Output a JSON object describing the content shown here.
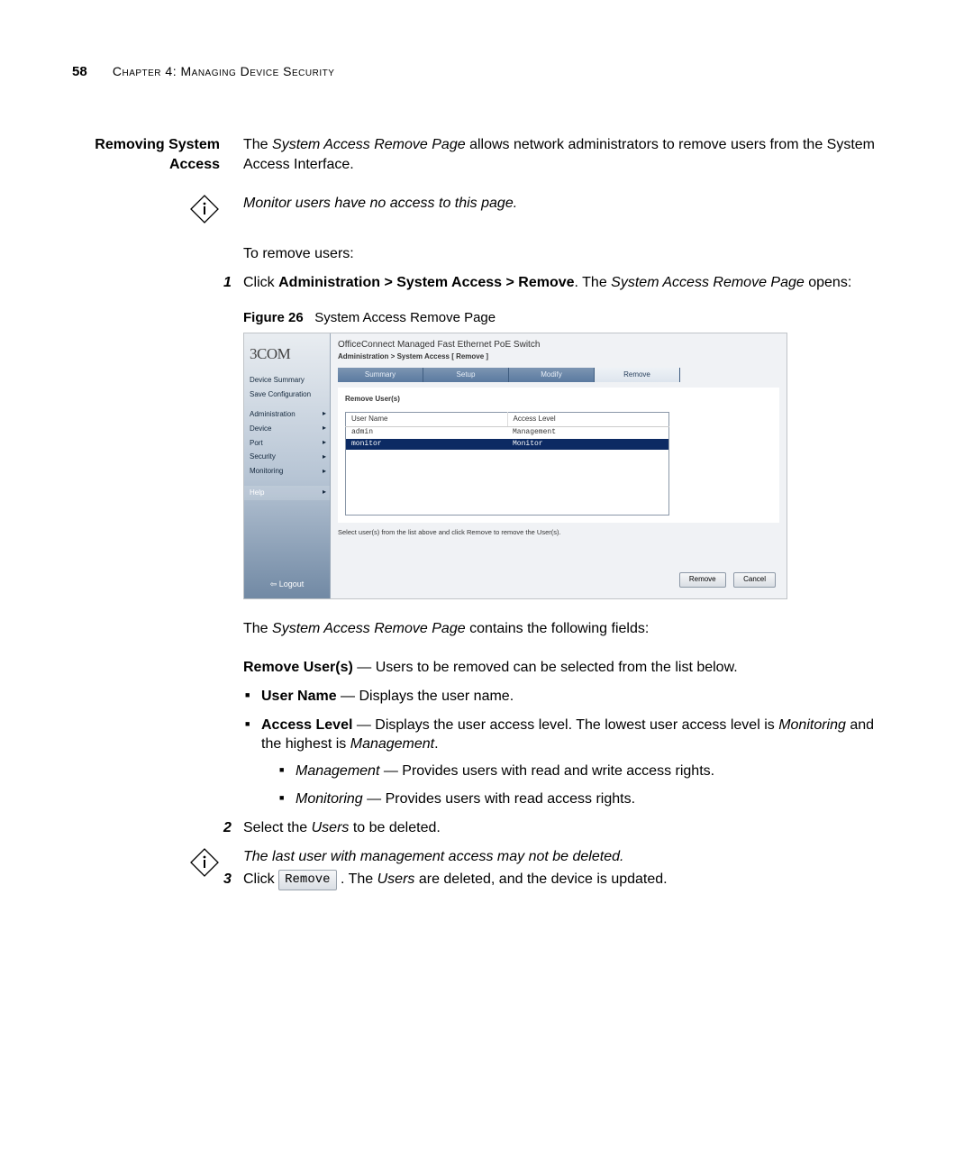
{
  "header": {
    "page_number": "58",
    "chapter_label": "Chapter 4: Managing Device Security"
  },
  "section": {
    "title_line1": "Removing System",
    "title_line2": "Access",
    "intro_pre": "The ",
    "intro_em": "System Access Remove Page",
    "intro_post": " allows network administrators to remove users from the System Access Interface.",
    "note1": "Monitor users have no access to this page.",
    "to_remove": "To remove users:"
  },
  "steps": {
    "s1_num": "1",
    "s1_pre": "Click ",
    "s1_path": "Administration > System Access > Remove",
    "s1_mid": ". The ",
    "s1_em": "System Access Remove Page",
    "s1_post": " opens:",
    "s2_num": "2",
    "s2_pre": "Select the ",
    "s2_em": "Users",
    "s2_post": " to be deleted.",
    "note2": "The last user with management access may not be deleted.",
    "s3_num": "3",
    "s3_pre": "Click ",
    "s3_btn": "Remove",
    "s3_mid": ". The ",
    "s3_em": "Users",
    "s3_post": " are deleted, and the device is updated."
  },
  "figure": {
    "label": "Figure 26",
    "caption": "System Access Remove Page"
  },
  "screenshot": {
    "brand": "3COM",
    "title": "OfficeConnect Managed Fast Ethernet PoE Switch",
    "breadcrumb": "Administration > System Access [ Remove ]",
    "nav": {
      "device_summary": "Device Summary",
      "save_config": "Save Configuration",
      "administration": "Administration",
      "device": "Device",
      "port": "Port",
      "security": "Security",
      "monitoring": "Monitoring",
      "help": "Help",
      "logout": "Logout"
    },
    "tabs": {
      "summary": "Summary",
      "setup": "Setup",
      "modify": "Modify",
      "remove": "Remove"
    },
    "panel": {
      "title": "Remove User(s)",
      "col_user": "User Name",
      "col_level": "Access Level",
      "rows": [
        {
          "user": "admin",
          "level": "Management"
        },
        {
          "user": "monitor",
          "level": "Monitor"
        }
      ],
      "hint": "Select user(s) from the list above and click Remove to remove the User(s).",
      "btn_remove": "Remove",
      "btn_cancel": "Cancel"
    }
  },
  "fields": {
    "intro_pre": "The ",
    "intro_em": "System Access Remove Page",
    "intro_post": " contains the following fields:",
    "remove_users_label": "Remove User(s)",
    "remove_users_text": " — Users to be removed can be selected from the list below.",
    "user_name_label": "User Name",
    "user_name_text": " — Displays the user name.",
    "access_level_label": "Access Level",
    "access_level_text_pre": " — Displays the user access level. The lowest user access level is ",
    "access_level_em1": "Monitoring",
    "access_level_mid": " and the highest is ",
    "access_level_em2": "Management",
    "access_level_post": ".",
    "mgmt_label": "Management",
    "mgmt_text": " — Provides users with read and write access rights.",
    "mon_label": "Monitoring",
    "mon_text": " — Provides users with read access rights."
  }
}
